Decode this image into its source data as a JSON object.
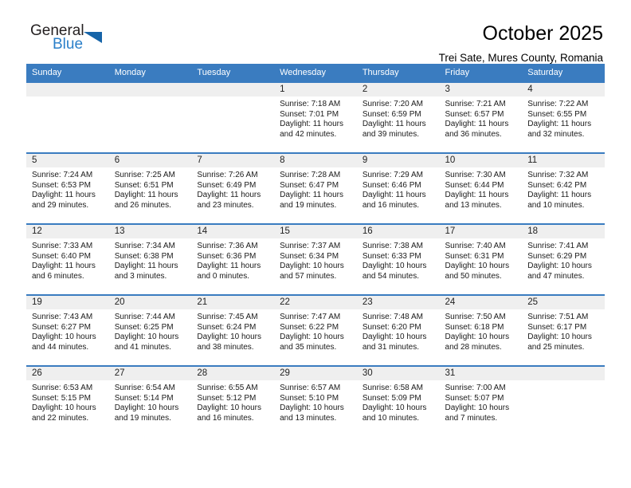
{
  "brand": {
    "line1": "General",
    "line2": "Blue",
    "accent_color": "#2a7fc9",
    "triangle_color": "#1664a8"
  },
  "header": {
    "title": "October 2025",
    "subtitle": "Trei Sate, Mures County, Romania"
  },
  "calendar": {
    "header_color": "#3a7cc0",
    "daynum_band_color": "#efefef",
    "weekdays": [
      "Sunday",
      "Monday",
      "Tuesday",
      "Wednesday",
      "Thursday",
      "Friday",
      "Saturday"
    ],
    "weeks": [
      [
        {
          "day": "",
          "sunrise": "",
          "sunset": "",
          "daylight": "",
          "empty": true
        },
        {
          "day": "",
          "sunrise": "",
          "sunset": "",
          "daylight": "",
          "empty": true
        },
        {
          "day": "",
          "sunrise": "",
          "sunset": "",
          "daylight": "",
          "empty": true
        },
        {
          "day": "1",
          "sunrise": "Sunrise: 7:18 AM",
          "sunset": "Sunset: 7:01 PM",
          "daylight": "Daylight: 11 hours and 42 minutes."
        },
        {
          "day": "2",
          "sunrise": "Sunrise: 7:20 AM",
          "sunset": "Sunset: 6:59 PM",
          "daylight": "Daylight: 11 hours and 39 minutes."
        },
        {
          "day": "3",
          "sunrise": "Sunrise: 7:21 AM",
          "sunset": "Sunset: 6:57 PM",
          "daylight": "Daylight: 11 hours and 36 minutes."
        },
        {
          "day": "4",
          "sunrise": "Sunrise: 7:22 AM",
          "sunset": "Sunset: 6:55 PM",
          "daylight": "Daylight: 11 hours and 32 minutes."
        }
      ],
      [
        {
          "day": "5",
          "sunrise": "Sunrise: 7:24 AM",
          "sunset": "Sunset: 6:53 PM",
          "daylight": "Daylight: 11 hours and 29 minutes."
        },
        {
          "day": "6",
          "sunrise": "Sunrise: 7:25 AM",
          "sunset": "Sunset: 6:51 PM",
          "daylight": "Daylight: 11 hours and 26 minutes."
        },
        {
          "day": "7",
          "sunrise": "Sunrise: 7:26 AM",
          "sunset": "Sunset: 6:49 PM",
          "daylight": "Daylight: 11 hours and 23 minutes."
        },
        {
          "day": "8",
          "sunrise": "Sunrise: 7:28 AM",
          "sunset": "Sunset: 6:47 PM",
          "daylight": "Daylight: 11 hours and 19 minutes."
        },
        {
          "day": "9",
          "sunrise": "Sunrise: 7:29 AM",
          "sunset": "Sunset: 6:46 PM",
          "daylight": "Daylight: 11 hours and 16 minutes."
        },
        {
          "day": "10",
          "sunrise": "Sunrise: 7:30 AM",
          "sunset": "Sunset: 6:44 PM",
          "daylight": "Daylight: 11 hours and 13 minutes."
        },
        {
          "day": "11",
          "sunrise": "Sunrise: 7:32 AM",
          "sunset": "Sunset: 6:42 PM",
          "daylight": "Daylight: 11 hours and 10 minutes."
        }
      ],
      [
        {
          "day": "12",
          "sunrise": "Sunrise: 7:33 AM",
          "sunset": "Sunset: 6:40 PM",
          "daylight": "Daylight: 11 hours and 6 minutes."
        },
        {
          "day": "13",
          "sunrise": "Sunrise: 7:34 AM",
          "sunset": "Sunset: 6:38 PM",
          "daylight": "Daylight: 11 hours and 3 minutes."
        },
        {
          "day": "14",
          "sunrise": "Sunrise: 7:36 AM",
          "sunset": "Sunset: 6:36 PM",
          "daylight": "Daylight: 11 hours and 0 minutes."
        },
        {
          "day": "15",
          "sunrise": "Sunrise: 7:37 AM",
          "sunset": "Sunset: 6:34 PM",
          "daylight": "Daylight: 10 hours and 57 minutes."
        },
        {
          "day": "16",
          "sunrise": "Sunrise: 7:38 AM",
          "sunset": "Sunset: 6:33 PM",
          "daylight": "Daylight: 10 hours and 54 minutes."
        },
        {
          "day": "17",
          "sunrise": "Sunrise: 7:40 AM",
          "sunset": "Sunset: 6:31 PM",
          "daylight": "Daylight: 10 hours and 50 minutes."
        },
        {
          "day": "18",
          "sunrise": "Sunrise: 7:41 AM",
          "sunset": "Sunset: 6:29 PM",
          "daylight": "Daylight: 10 hours and 47 minutes."
        }
      ],
      [
        {
          "day": "19",
          "sunrise": "Sunrise: 7:43 AM",
          "sunset": "Sunset: 6:27 PM",
          "daylight": "Daylight: 10 hours and 44 minutes."
        },
        {
          "day": "20",
          "sunrise": "Sunrise: 7:44 AM",
          "sunset": "Sunset: 6:25 PM",
          "daylight": "Daylight: 10 hours and 41 minutes."
        },
        {
          "day": "21",
          "sunrise": "Sunrise: 7:45 AM",
          "sunset": "Sunset: 6:24 PM",
          "daylight": "Daylight: 10 hours and 38 minutes."
        },
        {
          "day": "22",
          "sunrise": "Sunrise: 7:47 AM",
          "sunset": "Sunset: 6:22 PM",
          "daylight": "Daylight: 10 hours and 35 minutes."
        },
        {
          "day": "23",
          "sunrise": "Sunrise: 7:48 AM",
          "sunset": "Sunset: 6:20 PM",
          "daylight": "Daylight: 10 hours and 31 minutes."
        },
        {
          "day": "24",
          "sunrise": "Sunrise: 7:50 AM",
          "sunset": "Sunset: 6:18 PM",
          "daylight": "Daylight: 10 hours and 28 minutes."
        },
        {
          "day": "25",
          "sunrise": "Sunrise: 7:51 AM",
          "sunset": "Sunset: 6:17 PM",
          "daylight": "Daylight: 10 hours and 25 minutes."
        }
      ],
      [
        {
          "day": "26",
          "sunrise": "Sunrise: 6:53 AM",
          "sunset": "Sunset: 5:15 PM",
          "daylight": "Daylight: 10 hours and 22 minutes."
        },
        {
          "day": "27",
          "sunrise": "Sunrise: 6:54 AM",
          "sunset": "Sunset: 5:14 PM",
          "daylight": "Daylight: 10 hours and 19 minutes."
        },
        {
          "day": "28",
          "sunrise": "Sunrise: 6:55 AM",
          "sunset": "Sunset: 5:12 PM",
          "daylight": "Daylight: 10 hours and 16 minutes."
        },
        {
          "day": "29",
          "sunrise": "Sunrise: 6:57 AM",
          "sunset": "Sunset: 5:10 PM",
          "daylight": "Daylight: 10 hours and 13 minutes."
        },
        {
          "day": "30",
          "sunrise": "Sunrise: 6:58 AM",
          "sunset": "Sunset: 5:09 PM",
          "daylight": "Daylight: 10 hours and 10 minutes."
        },
        {
          "day": "31",
          "sunrise": "Sunrise: 7:00 AM",
          "sunset": "Sunset: 5:07 PM",
          "daylight": "Daylight: 10 hours and 7 minutes."
        },
        {
          "day": "",
          "sunrise": "",
          "sunset": "",
          "daylight": "",
          "empty": true
        }
      ]
    ]
  }
}
